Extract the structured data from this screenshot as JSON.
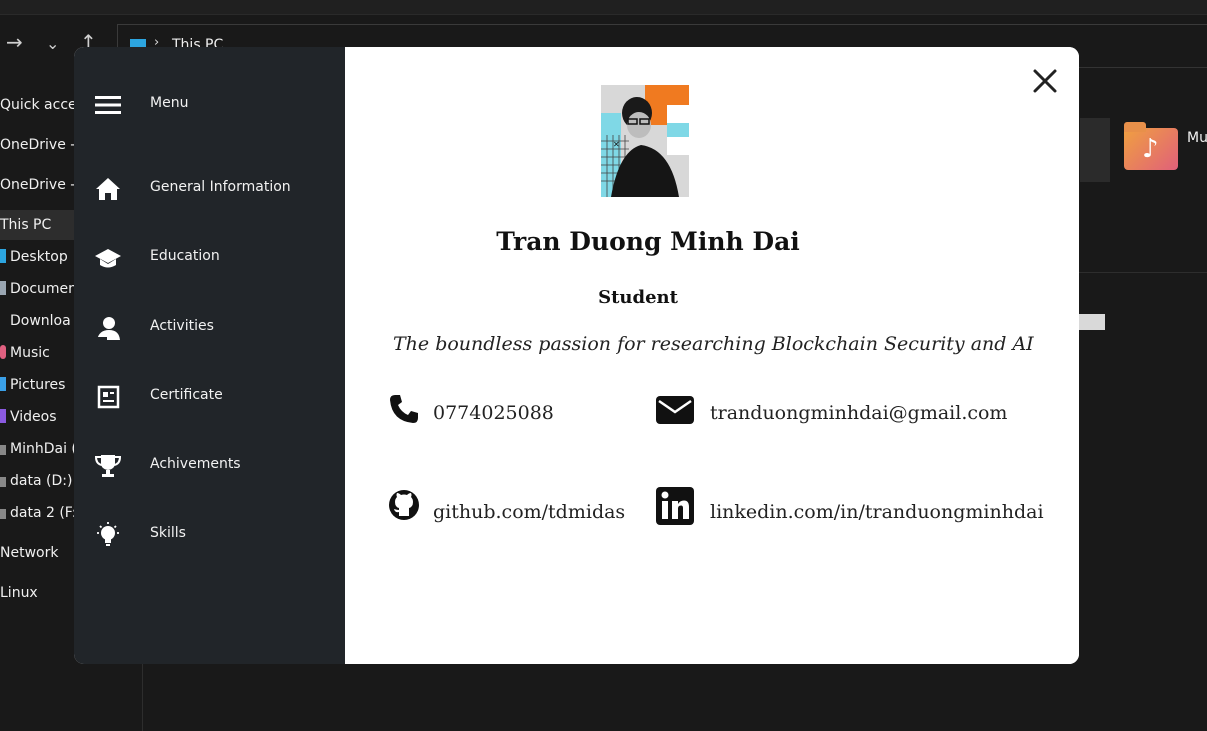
{
  "explorer": {
    "address": "This PC",
    "sidebar": [
      "Quick acces",
      "OneDrive -",
      "OneDrive -",
      "This PC",
      "Desktop",
      "Documen",
      "Downloa",
      "Music",
      "Pictures",
      "Videos",
      "MinhDai (",
      "data (D:)",
      "data 2 (F:)",
      "Network",
      "Linux"
    ],
    "tile_label": "Mu"
  },
  "menu": {
    "header": "Menu",
    "items": [
      {
        "label": "General Information",
        "icon": "home-icon"
      },
      {
        "label": "Education",
        "icon": "graduation-cap-icon"
      },
      {
        "label": "Activities",
        "icon": "user-icon"
      },
      {
        "label": "Certificate",
        "icon": "certificate-icon"
      },
      {
        "label": "Achivements",
        "icon": "trophy-icon"
      },
      {
        "label": "Skills",
        "icon": "lightbulb-icon"
      }
    ]
  },
  "profile": {
    "name": "Tran Duong Minh Dai",
    "role": "Student",
    "tagline": "The boundless passion for researching Blockchain Security and AI",
    "phone": "0774025088",
    "email": "tranduongminhdai@gmail.com",
    "github": "github.com/tdmidas",
    "linkedin": "linkedin.com/in/tranduongminhdai"
  },
  "colors": {
    "menu_bg": "#212529",
    "desktop_bg": "#191919"
  }
}
